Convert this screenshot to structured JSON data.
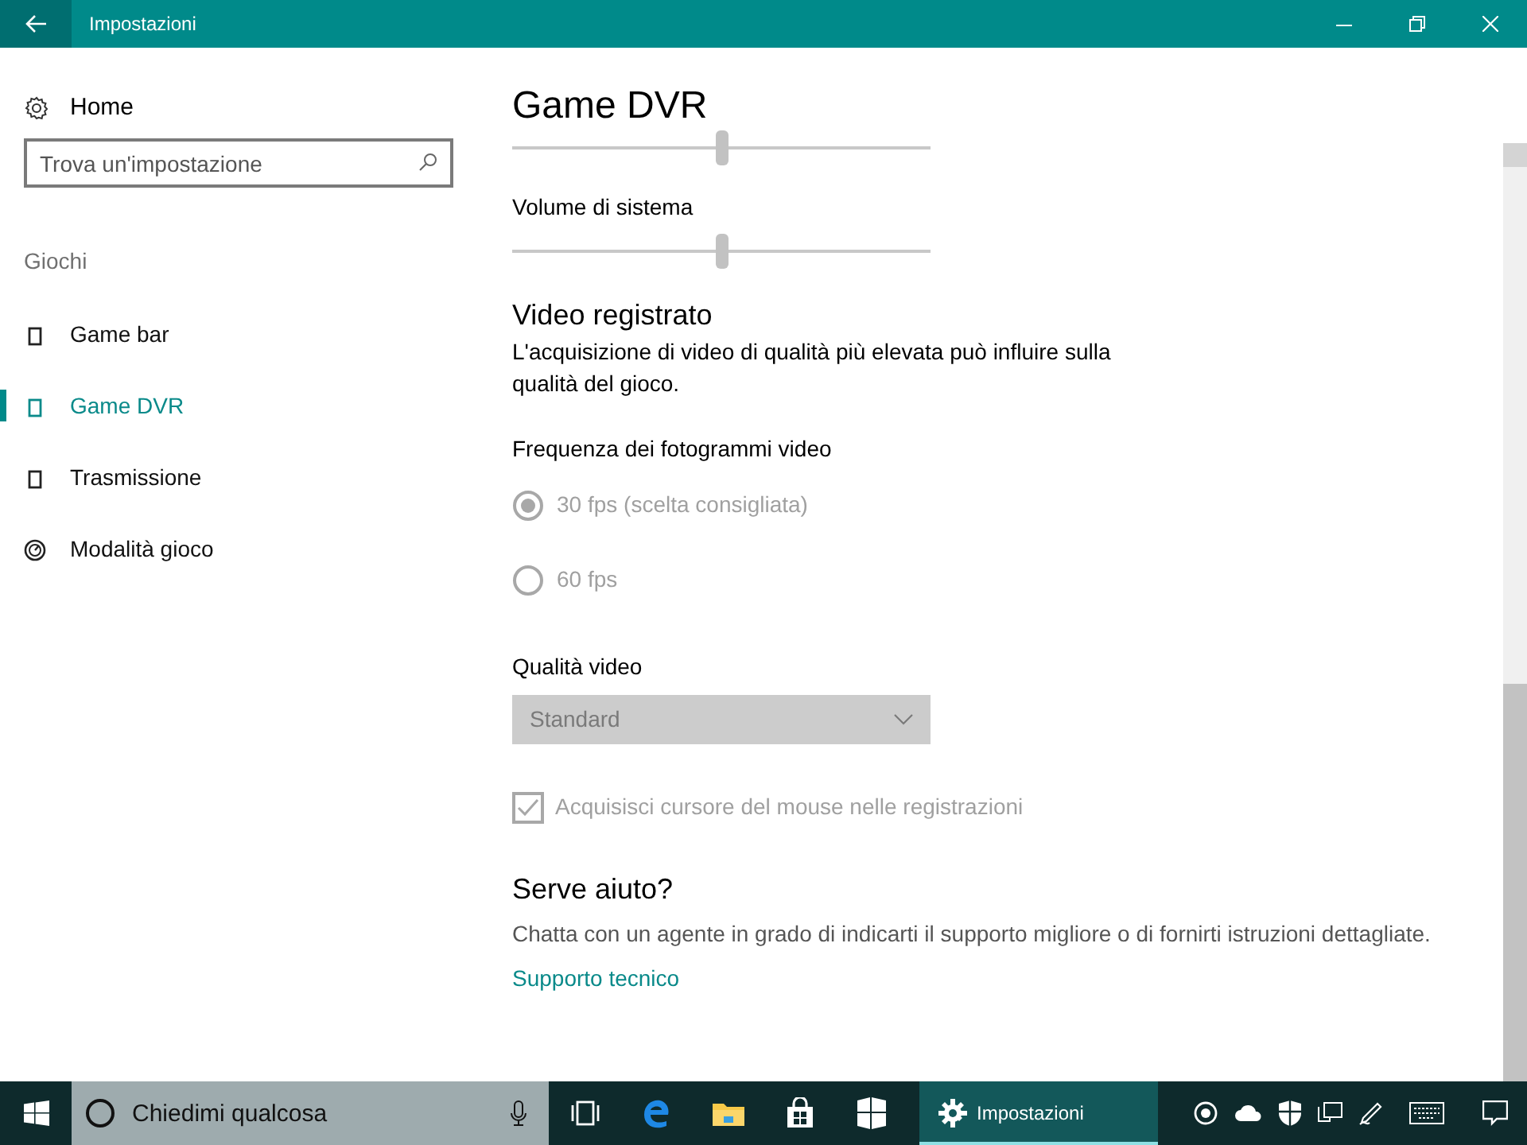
{
  "window": {
    "title": "Impostazioni"
  },
  "sidebar": {
    "home": "Home",
    "search": {
      "placeholder": "Trova un'impostazione"
    },
    "section": "Giochi",
    "items": [
      {
        "label": "Game bar",
        "kind": "device",
        "selected": false
      },
      {
        "label": "Game DVR",
        "kind": "device",
        "selected": true
      },
      {
        "label": "Trasmissione",
        "kind": "device",
        "selected": false
      },
      {
        "label": "Modalità gioco",
        "kind": "gauge",
        "selected": false
      }
    ]
  },
  "content": {
    "title": "Game DVR",
    "sliders": [
      {
        "level": 0.5
      },
      {
        "label": "Volume di sistema",
        "level": 0.5
      }
    ],
    "video": {
      "heading": "Video registrato",
      "description": "L'acquisizione di video di qualità più elevata può influire sulla qualità del gioco.",
      "frame_rate_label": "Frequenza dei fotogrammi video",
      "radios": [
        {
          "label": "30 fps (scelta consigliata)",
          "selected": true,
          "disabled": true
        },
        {
          "label": "60 fps",
          "selected": false,
          "disabled": true
        }
      ],
      "quality_label": "Qualità video",
      "quality": {
        "value": "Standard",
        "disabled": true
      },
      "checkbox": {
        "label": "Acquisisci cursore del mouse nelle registrazioni",
        "checked": true,
        "disabled": true
      }
    },
    "help": {
      "heading": "Serve aiuto?",
      "text": "Chatta con un agente in grado di indicarti il supporto migliore o di fornirti istruzioni dettagliate.",
      "link": "Supporto tecnico"
    }
  },
  "taskbar": {
    "search": {
      "placeholder": "Chiedimi qualcosa"
    },
    "apps": [
      {
        "kind": "taskview"
      },
      {
        "kind": "edge"
      },
      {
        "kind": "explorer"
      },
      {
        "kind": "store"
      },
      {
        "kind": "tiles"
      },
      {
        "kind": "settings",
        "label": "Impostazioni",
        "selected": true
      }
    ]
  }
}
